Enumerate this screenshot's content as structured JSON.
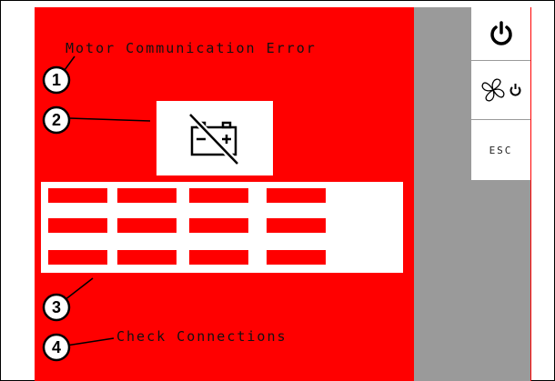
{
  "screen": {
    "title": "Motor Communication Error",
    "footer": "Check Connections"
  },
  "colors": {
    "background": "#ff0000",
    "side_panel": "#9a9a9a",
    "button_bg": "#ffffff",
    "text": "#111111"
  },
  "main_icon": {
    "name": "battery-disconnected-icon"
  },
  "side_buttons": [
    {
      "name": "power-icon"
    },
    {
      "name": "fan-power-icon"
    },
    {
      "label": "ESC"
    }
  ],
  "callouts": [
    "1",
    "2",
    "3",
    "4"
  ],
  "grid": {
    "rows": 3,
    "cols": 4
  }
}
